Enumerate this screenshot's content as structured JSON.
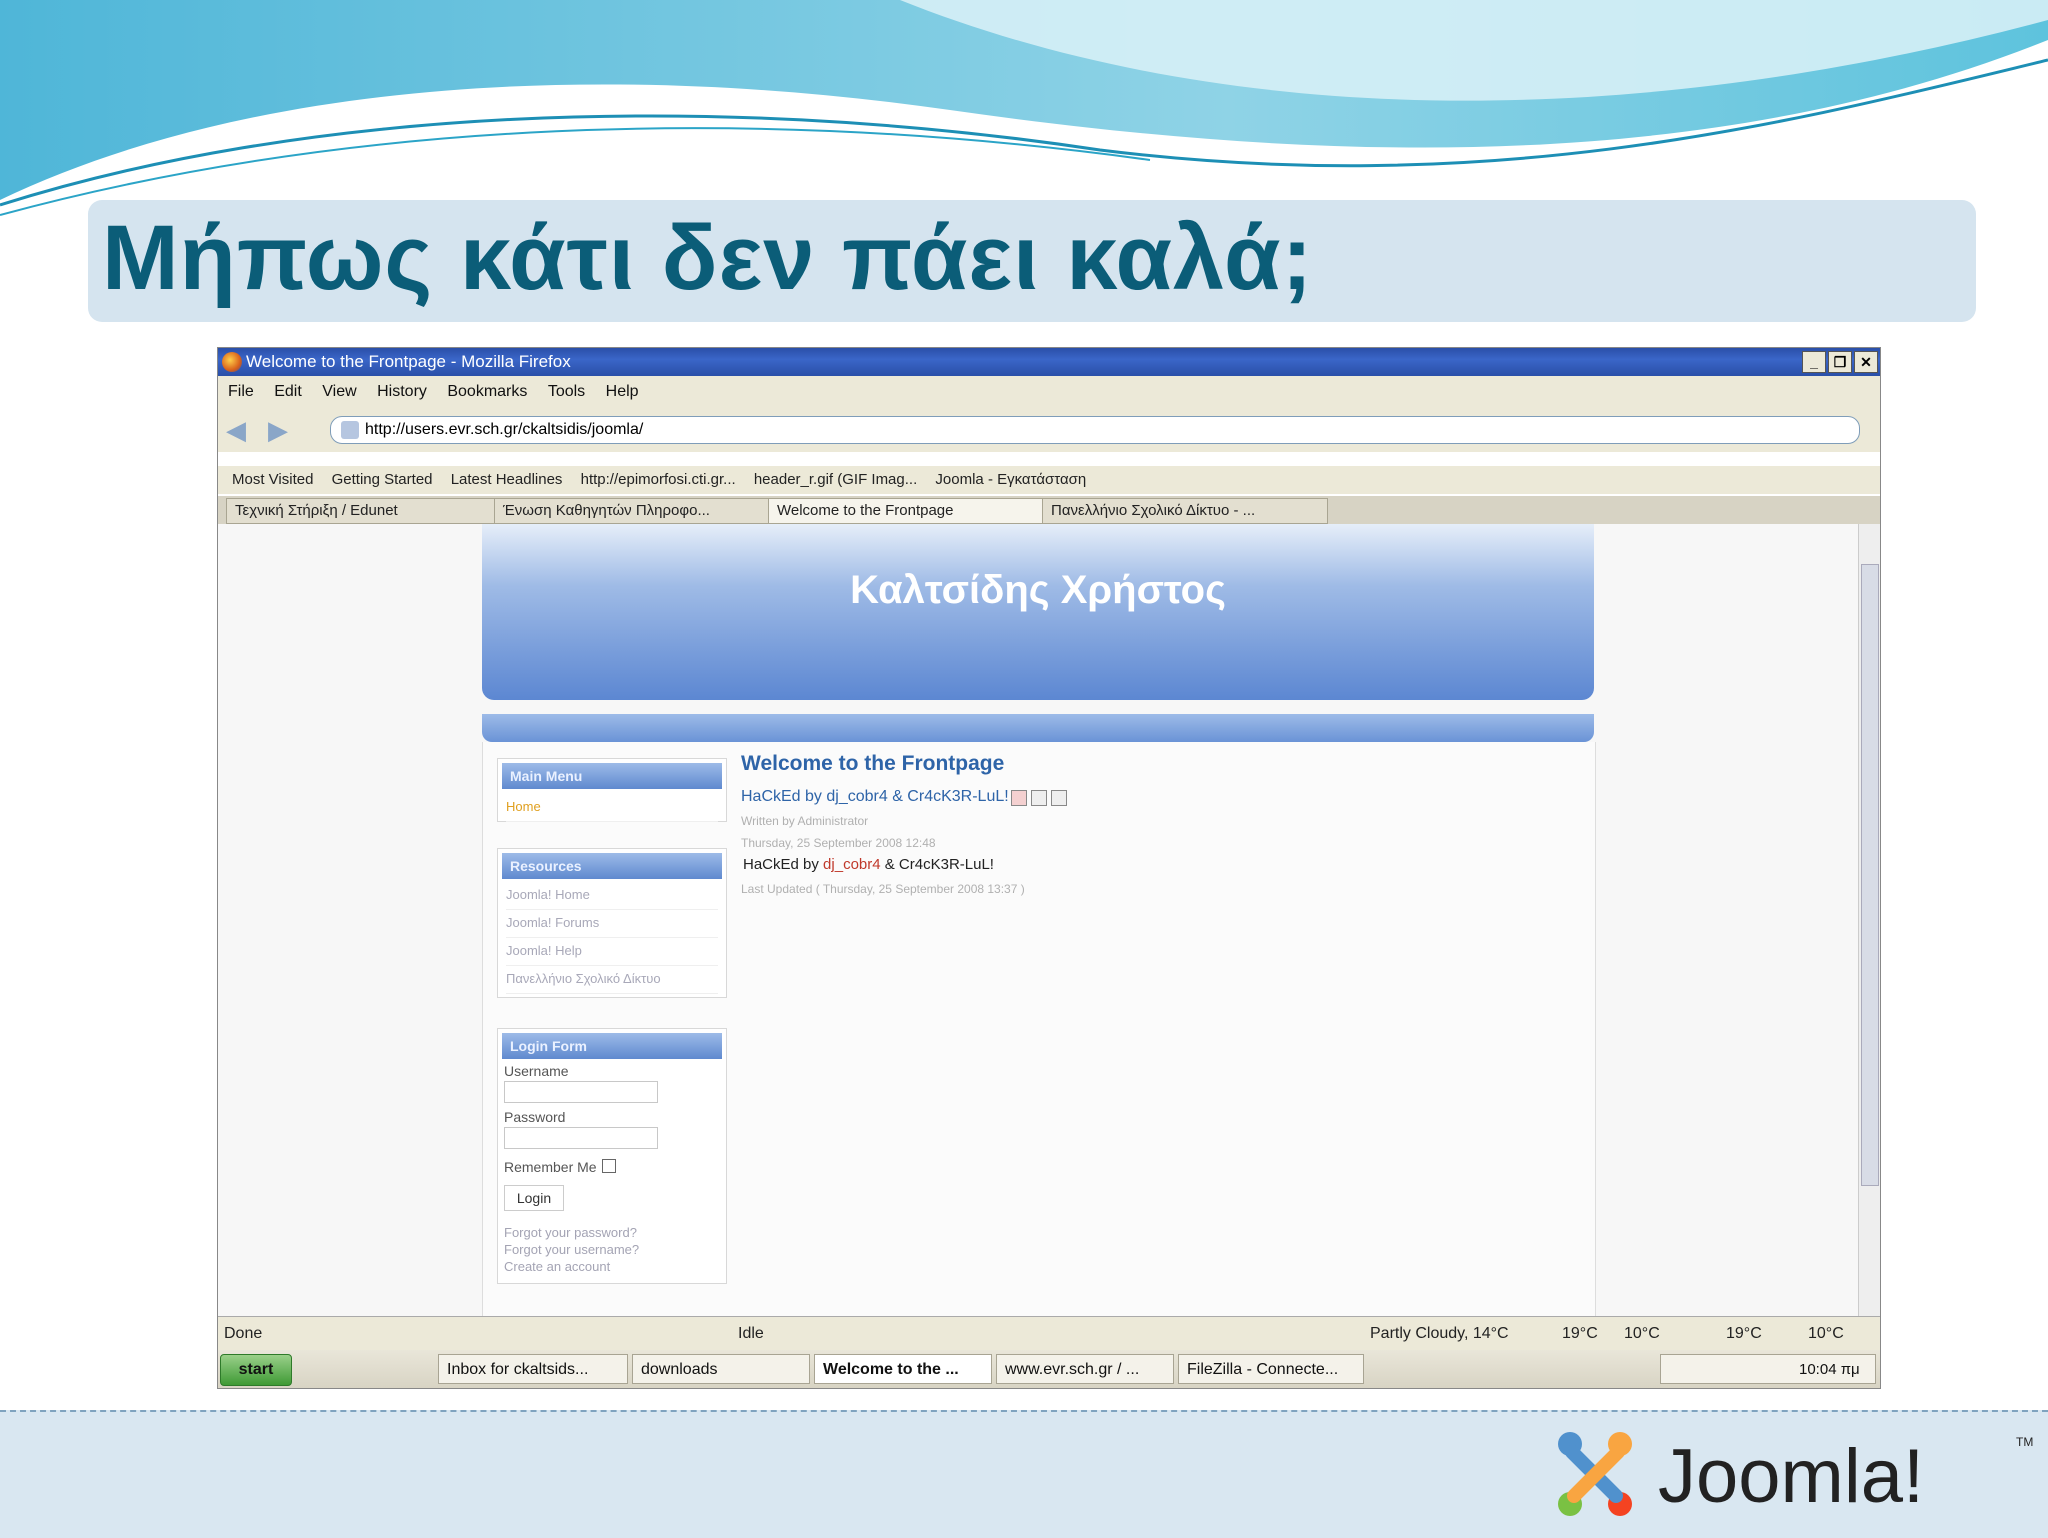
{
  "slide": {
    "title": "Μήπως κάτι δεν πάει καλά;",
    "logo_text": "Joomla!",
    "logo_tm": "TM"
  },
  "browser": {
    "window_title": "Welcome to the Frontpage - Mozilla Firefox",
    "menu": [
      "File",
      "Edit",
      "View",
      "History",
      "Bookmarks",
      "Tools",
      "Help"
    ],
    "url": "http://users.evr.sch.gr/ckaltsidis/joomla/",
    "bookmarks": [
      "Most Visited",
      "Getting Started",
      "Latest Headlines",
      "http://epimorfosi.cti.gr...",
      "header_r.gif (GIF Imag...",
      "Joomla - Εγκατάσταση"
    ],
    "tabs": [
      "Τεχνική Στήριξη / Edunet",
      "Ένωση Καθηγητών Πληροφο...",
      "Welcome to the Frontpage",
      "Πανελλήνιο Σχολικό Δίκτυο - ..."
    ],
    "active_tab": "Welcome to the Frontpage",
    "status": "Done",
    "status_idle": "Idle",
    "weather": [
      "Partly Cloudy, 14°C",
      "19°C",
      "10°C",
      "19°C",
      "10°C"
    ]
  },
  "site": {
    "header_title": "Καλτσίδης Χρήστος",
    "main_menu": {
      "title": "Main Menu",
      "items": [
        "Home"
      ]
    },
    "resources": {
      "title": "Resources",
      "items": [
        "Joomla! Home",
        "Joomla! Forums",
        "Joomla! Help",
        "Πανελλήνιο Σχολικό Δίκτυο"
      ]
    },
    "login": {
      "title": "Login Form",
      "username_label": "Username",
      "password_label": "Password",
      "remember_label": "Remember Me",
      "login_button": "Login",
      "links": [
        "Forgot your password?",
        "Forgot your username?",
        "Create an account"
      ]
    },
    "content": {
      "title": "Welcome to the Frontpage",
      "article_title": "HaCkEd by dj_cobr4 & Cr4cK3R-LuL!",
      "written_by": "Written by Administrator",
      "date": "Thursday, 25 September 2008 12:48",
      "body_prefix": "HaCkEd by ",
      "body_red": "dj_cobr4",
      "body_suffix": " & Cr4cK3R-LuL!",
      "last_updated": "Last Updated ( Thursday, 25 September 2008 13:37 )"
    }
  },
  "taskbar": {
    "start": "start",
    "tasks": [
      "Inbox for ckaltsids...",
      "downloads",
      "Welcome to the ...",
      "www.evr.sch.gr / ...",
      "FileZilla - Connecte..."
    ],
    "active_task": "Welcome to the ...",
    "clock": "10:04 πμ"
  }
}
